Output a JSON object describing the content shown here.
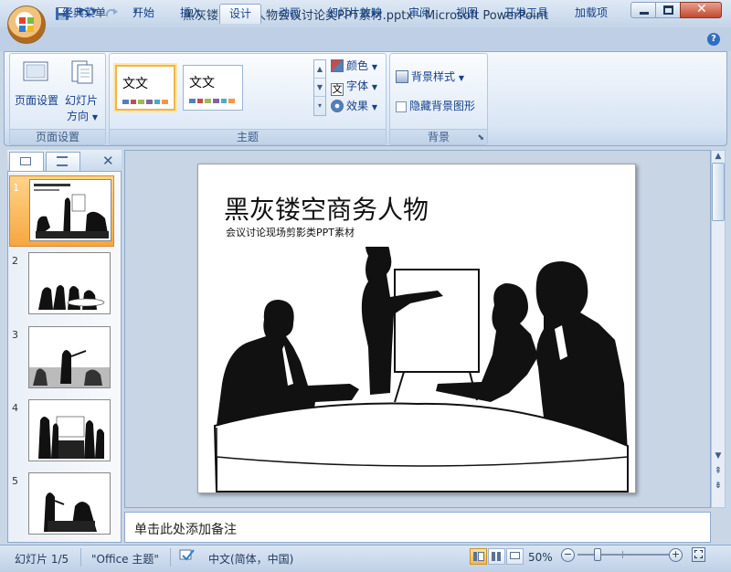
{
  "window": {
    "title": "黑灰镂空商务人物会议讨论类PPT素材.pptx - Microsoft PowerPoint"
  },
  "quick_access": {
    "icons": [
      "save-icon",
      "undo-icon",
      "redo-icon",
      "customize-icon"
    ]
  },
  "tabs": [
    {
      "label": "经典菜单"
    },
    {
      "label": "开始"
    },
    {
      "label": "插入"
    },
    {
      "label": "设计"
    },
    {
      "label": "动画"
    },
    {
      "label": "幻灯片放映"
    },
    {
      "label": "审阅"
    },
    {
      "label": "视图"
    },
    {
      "label": "开发工具"
    },
    {
      "label": "加载项"
    }
  ],
  "active_tab": "设计",
  "ribbon": {
    "page_setup": {
      "group_label": "页面设置",
      "page_setup_btn": "页面设置",
      "orientation_btn_line1": "幻灯片",
      "orientation_btn_line2": "方向"
    },
    "theme": {
      "group_label": "主题",
      "thumbs": [
        {
          "text": "文文"
        },
        {
          "text": "文文"
        }
      ],
      "colors_btn": "颜色",
      "fonts_btn": "字体",
      "effects_btn": "效果",
      "fonts_icon_glyph": "文"
    },
    "background": {
      "group_label": "背景",
      "styles_btn": "背景样式",
      "hide_graphics": "隐藏背景图形",
      "hide_checked": false
    }
  },
  "slides_panel": {
    "slides": [
      {
        "num": "1"
      },
      {
        "num": "2"
      },
      {
        "num": "3"
      },
      {
        "num": "4"
      },
      {
        "num": "5"
      }
    ],
    "active": 1
  },
  "slide": {
    "title": "黑灰镂空商务人物",
    "subtitle": "会议讨论现场剪影类PPT素材"
  },
  "notes": {
    "placeholder": "单击此处添加备注"
  },
  "status": {
    "slide_indicator": "幻灯片 1/5",
    "theme": "\"Office 主题\"",
    "language": "中文(简体，中国)",
    "zoom": "50%",
    "zoom_fraction": 0.5
  },
  "colors": {
    "accent": "#f0b44c",
    "ribbon_bg": "#dbe6f4",
    "title_text": "#1e395b"
  }
}
